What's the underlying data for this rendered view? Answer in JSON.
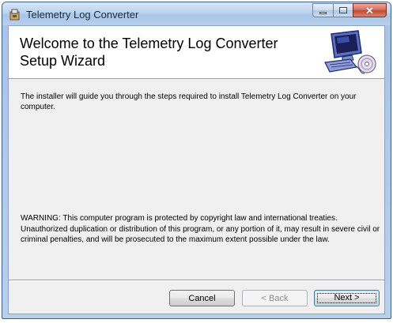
{
  "window": {
    "title": "Telemetry Log Converter",
    "controls": {
      "minimize": "minimize-icon",
      "maximize": "maximize-icon",
      "close": "close-icon"
    }
  },
  "banner": {
    "heading": "Welcome to the Telemetry Log Converter Setup Wizard",
    "graphic": "computer-setup-icon"
  },
  "body": {
    "intro": "The installer will guide you through the steps required to install Telemetry Log Converter on your computer.",
    "warning": "WARNING: This computer program is protected by copyright law and international treaties. Unauthorized duplication or distribution of this program, or any portion of it, may result in severe civil or criminal penalties, and will be prosecuted to the maximum extent possible under the law."
  },
  "buttons": {
    "cancel": "Cancel",
    "back": "< Back",
    "next": "Next >"
  },
  "colors": {
    "title_bar": "#b9d0ec",
    "client": "#f0f0f0",
    "banner": "#ffffff",
    "close_button": "#c24a33"
  }
}
